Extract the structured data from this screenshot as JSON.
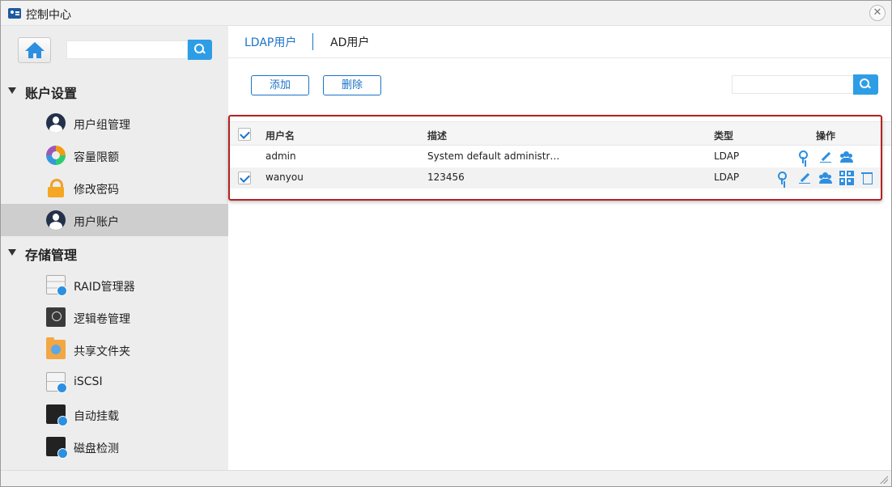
{
  "window": {
    "title": "控制中心"
  },
  "sidebar": {
    "search": {
      "placeholder": ""
    },
    "sections": [
      {
        "label": "账户设置",
        "items": [
          {
            "label": "用户组管理",
            "icon": "user-group-icon"
          },
          {
            "label": "容量限额",
            "icon": "quota-pie-icon"
          },
          {
            "label": "修改密码",
            "icon": "lock-icon"
          },
          {
            "label": "用户账户",
            "icon": "user-account-icon",
            "active": true
          }
        ]
      },
      {
        "label": "存储管理",
        "items": [
          {
            "label": "RAID管理器",
            "icon": "raid-icon"
          },
          {
            "label": "逻辑卷管理",
            "icon": "lvm-icon"
          },
          {
            "label": "共享文件夹",
            "icon": "shared-folder-icon"
          },
          {
            "label": "iSCSI",
            "icon": "iscsi-icon"
          },
          {
            "label": "自动挂载",
            "icon": "auto-mount-icon"
          },
          {
            "label": "磁盘检测",
            "icon": "disk-check-icon"
          }
        ]
      }
    ]
  },
  "main": {
    "tabs": [
      {
        "label": "LDAP用户",
        "active": true
      },
      {
        "label": "AD用户"
      }
    ],
    "toolbar": {
      "add_label": "添加",
      "delete_label": "删除",
      "search_placeholder": ""
    },
    "table": {
      "headers": {
        "name": "用户名",
        "desc": "描述",
        "type": "类型",
        "ops": "操作"
      },
      "rows": [
        {
          "name": "admin",
          "desc": "System default administr…",
          "type": "LDAP",
          "checked": false,
          "ops": [
            "key-icon",
            "edit-icon",
            "group-icon"
          ]
        },
        {
          "name": "wanyou",
          "desc": "123456",
          "type": "LDAP",
          "checked": true,
          "ops": [
            "key-icon",
            "edit-icon",
            "group-icon",
            "grid-icon",
            "trash-icon"
          ]
        }
      ]
    }
  },
  "colors": {
    "accent": "#1a73c8",
    "search_button": "#2d9ee6",
    "highlight_border": "#b22222",
    "sidebar_bg": "#ededed",
    "active_item_bg": "#cecece"
  }
}
